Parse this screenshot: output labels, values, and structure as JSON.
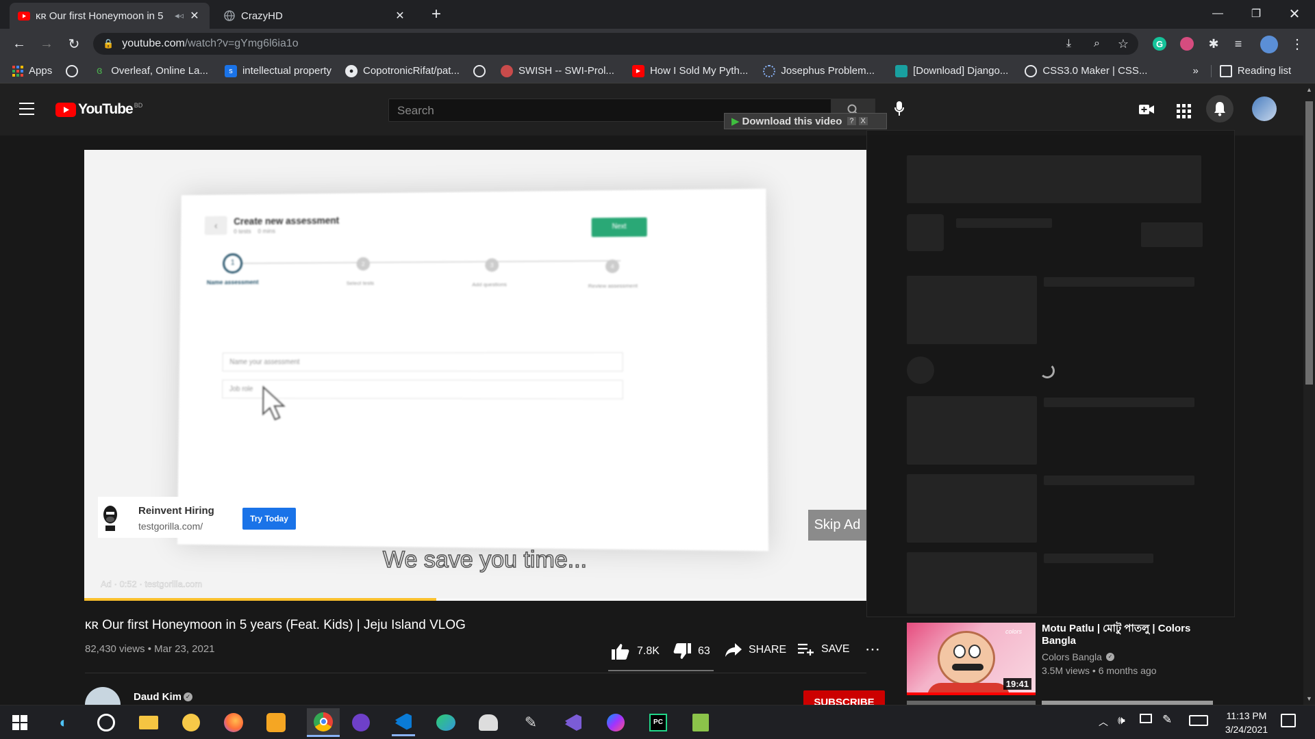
{
  "browser": {
    "tabs": [
      {
        "label": "ᴋʀ Our first Honeymoon in 5",
        "active": true
      },
      {
        "label": "CrazyHD",
        "active": false
      }
    ],
    "url": {
      "host": "youtube.com",
      "path": "/watch?v=gYmg6l6ia1o"
    },
    "bookmarks": [
      "Apps",
      "Overleaf, Online La...",
      "intellectual property",
      "CopotronicRifat/pat...",
      "SWISH -- SWI-Prol...",
      "How I Sold My Pyth...",
      "Josephus Problem...",
      "[Download] Django...",
      "CSS3.0 Maker | CSS..."
    ],
    "reading_list": "Reading list",
    "overflow": "»"
  },
  "youtube": {
    "logo": "YouTube",
    "region": "BD",
    "search_placeholder": "Search",
    "download_label": "Download this video",
    "download_help": "?",
    "download_close": "X"
  },
  "ad": {
    "app_title": "Create new assessment",
    "app_meta": [
      "0 tests",
      "0 mins"
    ],
    "next_label": "Next",
    "steps": [
      "Name assessment",
      "Select tests",
      "Add questions",
      "Review assessment"
    ],
    "step_numbers": [
      "1",
      "2",
      "3",
      "4"
    ],
    "field1_placeholder": "Name your assessment",
    "field2_placeholder": "Job role",
    "advertiser": "Reinvent Hiring",
    "advertiser_url": "testgorilla.com/",
    "cta": "Try Today",
    "skip": "Skip Ad",
    "caption": "We save you time...",
    "badge": "Ad · 0:52 · testgorilla.com",
    "progress": 0.45
  },
  "video": {
    "title": "ᴋʀ Our first Honeymoon in 5 years (Feat. Kids) | Jeju Island VLOG",
    "meta": "82,430 views • Mar 23, 2021",
    "likes": "7.8K",
    "dislikes": "63",
    "share": "SHARE",
    "save": "SAVE",
    "channel": "Daud Kim",
    "subscribe": "SUBSCRIBE"
  },
  "sidebar": {
    "next_video": {
      "title": "Motu Patlu | মোটু পাতলু | Colors Bangla",
      "channel": "Colors Bangla",
      "meta": "3.5M views • 6 months ago",
      "duration": "19:41",
      "thumb_badge": "colors"
    }
  },
  "taskbar": {
    "time": "11:13 PM",
    "date": "3/24/2021"
  }
}
